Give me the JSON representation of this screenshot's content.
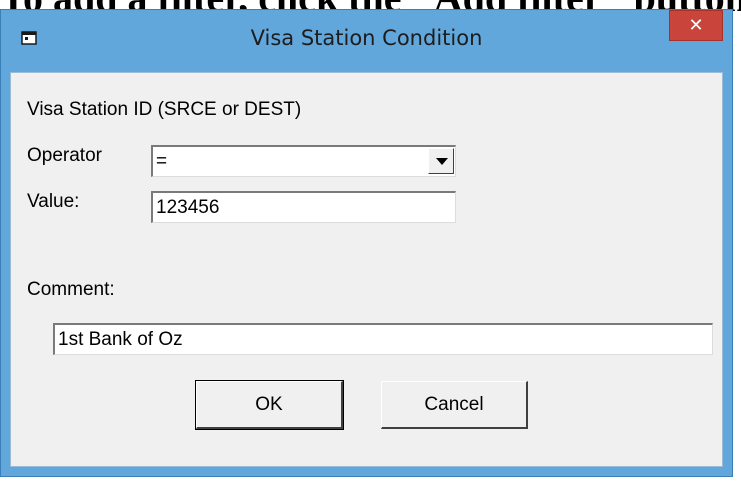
{
  "document": {
    "fragment_text": "To add a filter, click the \"Add filter\" button."
  },
  "window": {
    "title": "Visa Station Condition",
    "close_label": "✕"
  },
  "form": {
    "field_title": "Visa Station ID (SRCE or DEST)",
    "operator_label": "Operator",
    "operator_value": "=",
    "value_label": "Value:",
    "value_value": "123456",
    "comment_label": "Comment:",
    "comment_value": "1st Bank of Oz"
  },
  "buttons": {
    "ok_label": "OK",
    "cancel_label": "Cancel"
  },
  "icons": {
    "app": "dialog-app-icon",
    "close": "close-icon",
    "dropdown": "chevron-down-icon"
  },
  "colors": {
    "titlebar": "#62a7dc",
    "close_button": "#c9443a",
    "client_background": "#f0f0f0"
  }
}
